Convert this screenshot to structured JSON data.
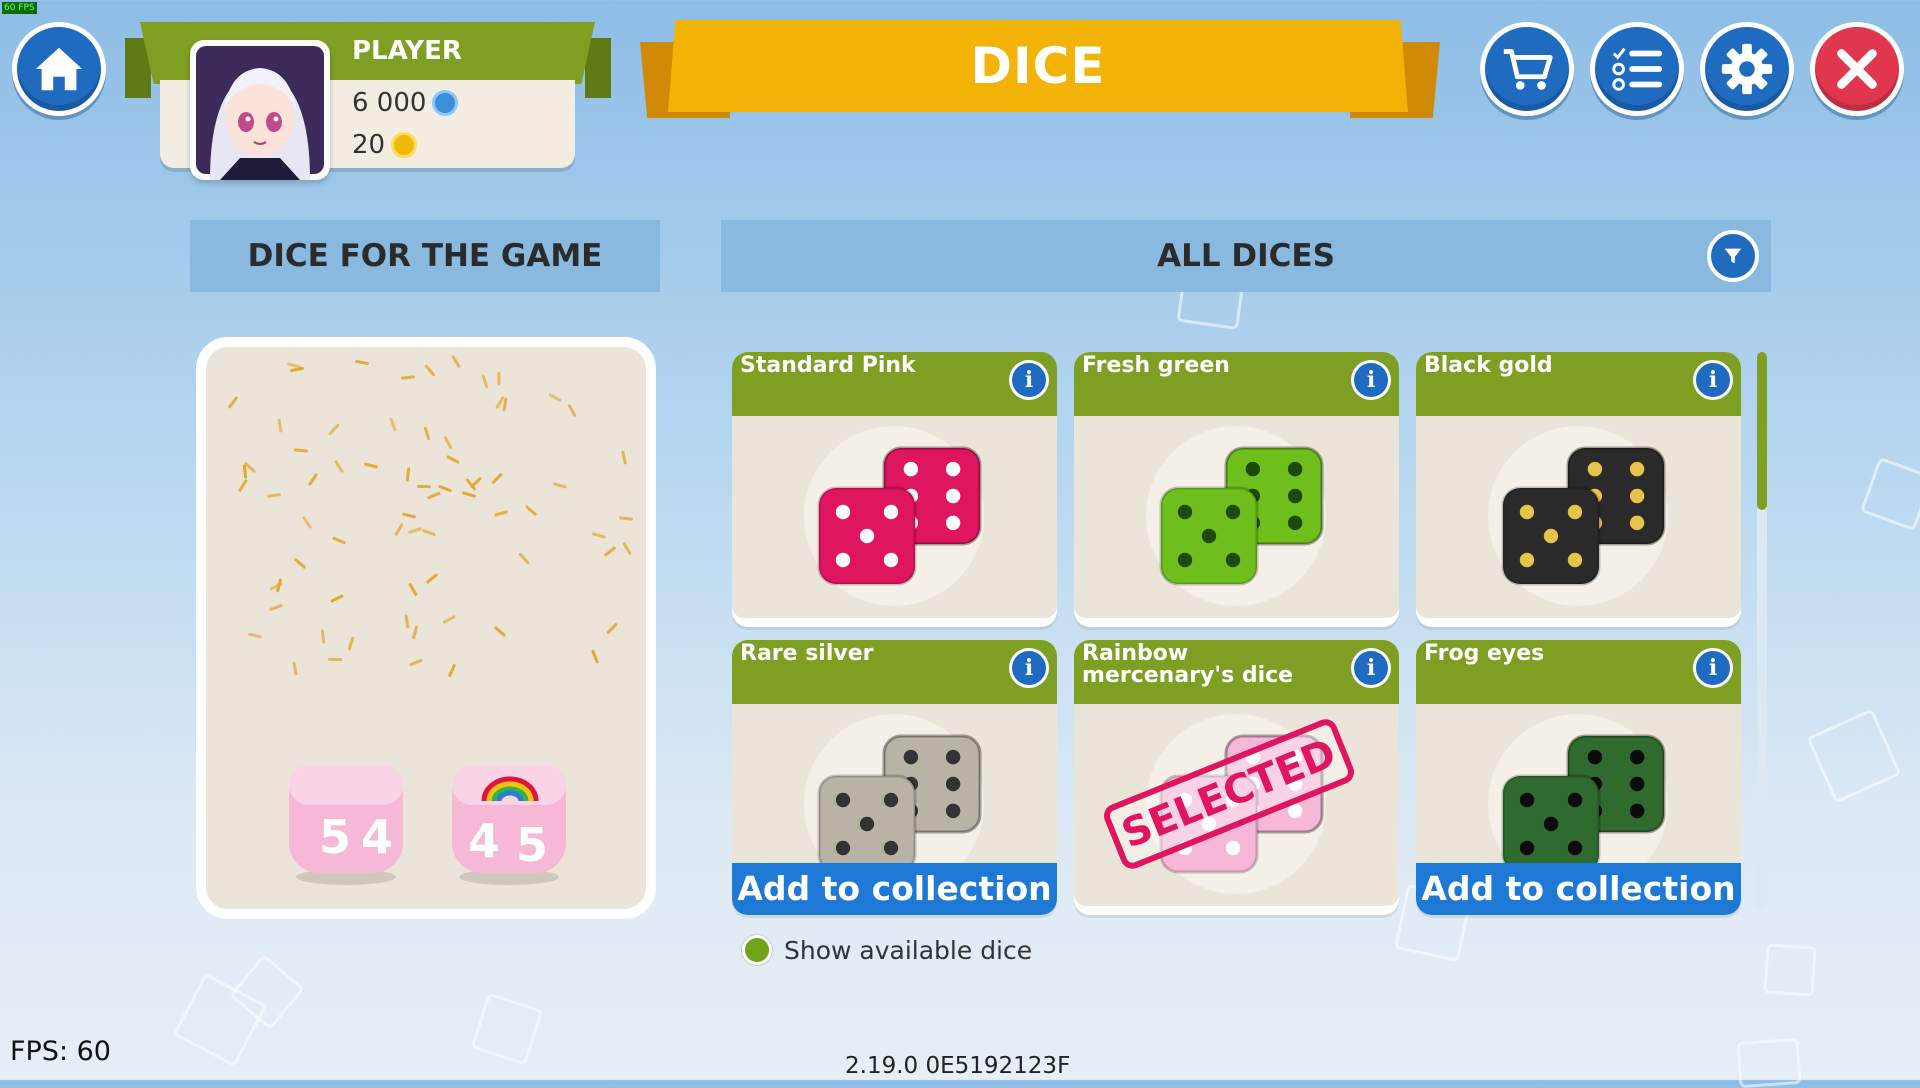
{
  "header": {
    "title": "DICE",
    "player": {
      "name": "PLAYER",
      "gems": "6 000",
      "coins": "20"
    },
    "icons": {
      "home": "home-icon",
      "shop": "cart-icon",
      "tasks": "checklist-icon",
      "settings": "gear-icon",
      "close": "close-icon"
    }
  },
  "sections": {
    "left_title": "DICE FOR THE GAME",
    "right_title": "ALL DICES"
  },
  "dice_cards": [
    {
      "name": "Standard Pink",
      "color": "#e0155f",
      "pip": "#ffffff",
      "action": ""
    },
    {
      "name": "Fresh green",
      "color": "#6fbf1c",
      "pip": "#1d4a0a",
      "action": ""
    },
    {
      "name": "Black gold",
      "color": "#2a2a2a",
      "pip": "#e6c34a",
      "action": ""
    },
    {
      "name": "Rare silver",
      "color": "#b9b3a5",
      "pip": "#333333",
      "action": "Add to collection"
    },
    {
      "name": "Rainbow mercenary's dice",
      "color": "#f7b8d8",
      "pip": "#ffffff",
      "action": "",
      "stamp": "SELECTED"
    },
    {
      "name": "Frog eyes",
      "color": "#2f6a2f",
      "pip": "#0b0b0b",
      "action": "Add to collection"
    }
  ],
  "selected_dice": {
    "faces": [
      "5",
      "4",
      "4",
      "5"
    ]
  },
  "filter": {
    "show_available": "Show available dice"
  },
  "footer": {
    "fps": "FPS: 60",
    "version": "2.19.0 0E5192123F",
    "corner_fps": "60 FPS"
  },
  "colors": {
    "accent_blue": "#1e6bc0",
    "ribbon_green": "#7e9f22",
    "title_yellow": "#f2b306",
    "close_red": "#e0374f"
  }
}
